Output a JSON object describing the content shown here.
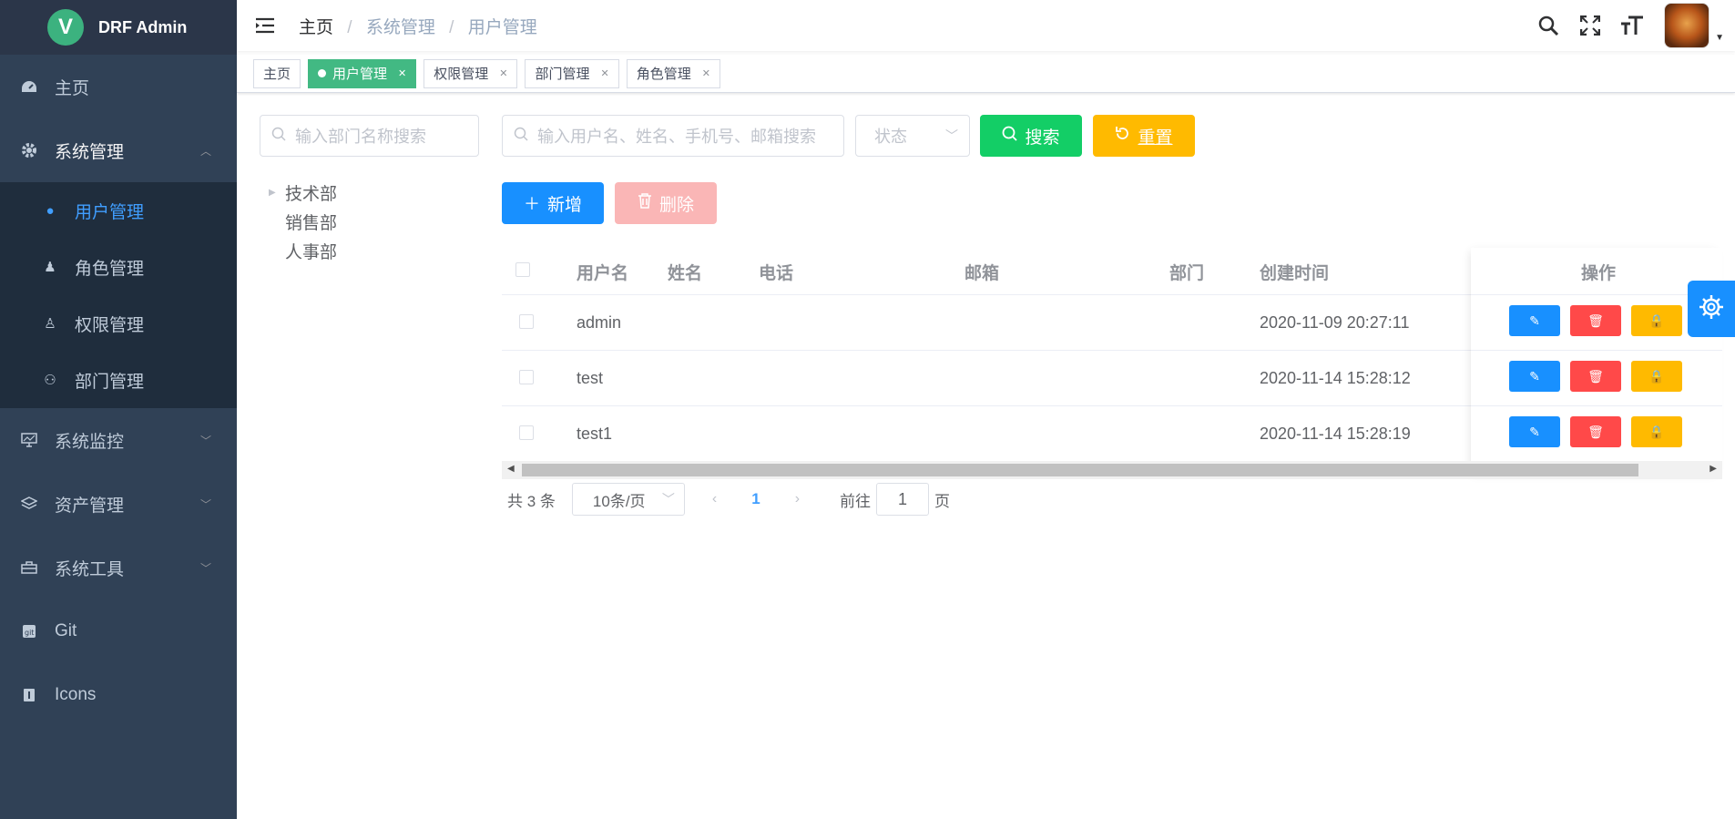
{
  "app": {
    "logo_letter": "V",
    "title": "DRF Admin"
  },
  "sidebar": {
    "items": [
      {
        "label": "主页",
        "icon": "dashboard-icon"
      },
      {
        "label": "系统管理",
        "icon": "gear-icon",
        "expanded": true,
        "children": [
          {
            "label": "用户管理",
            "icon": "user-icon",
            "active": true
          },
          {
            "label": "角色管理",
            "icon": "role-icon"
          },
          {
            "label": "权限管理",
            "icon": "permission-icon"
          },
          {
            "label": "部门管理",
            "icon": "org-tree-icon"
          }
        ]
      },
      {
        "label": "系统监控",
        "icon": "monitor-icon"
      },
      {
        "label": "资产管理",
        "icon": "layers-icon"
      },
      {
        "label": "系统工具",
        "icon": "toolbox-icon"
      },
      {
        "label": "Git",
        "icon": "git-icon"
      },
      {
        "label": "Icons",
        "icon": "icons-icon"
      }
    ]
  },
  "breadcrumb": [
    "主页",
    "系统管理",
    "用户管理"
  ],
  "tags": [
    {
      "label": "主页"
    },
    {
      "label": "用户管理",
      "active": true
    },
    {
      "label": "权限管理"
    },
    {
      "label": "部门管理"
    },
    {
      "label": "角色管理"
    }
  ],
  "dept_search": {
    "placeholder": "输入部门名称搜索"
  },
  "user_search": {
    "placeholder": "输入用户名、姓名、手机号、邮箱搜索"
  },
  "status_select": {
    "placeholder": "状态"
  },
  "buttons": {
    "search": "搜索",
    "reset": "重置",
    "add": "新增",
    "delete": "删除"
  },
  "dept_tree": [
    "技术部",
    "销售部",
    "人事部"
  ],
  "table": {
    "columns": [
      "用户名",
      "姓名",
      "电话",
      "邮箱",
      "部门",
      "创建时间",
      "操作"
    ],
    "rows": [
      {
        "username": "admin",
        "name": "",
        "phone": "",
        "email": "",
        "dept": "",
        "created": "2020-11-09 20:27:11"
      },
      {
        "username": "test",
        "name": "",
        "phone": "",
        "email": "",
        "dept": "",
        "created": "2020-11-14 15:28:12"
      },
      {
        "username": "test1",
        "name": "",
        "phone": "",
        "email": "",
        "dept": "",
        "created": "2020-11-14 15:28:19"
      }
    ]
  },
  "pagination": {
    "total_text": "共 3 条",
    "page_size": "10条/页",
    "current_page": "1",
    "goto_prefix": "前往",
    "goto_value": "1",
    "goto_suffix": "页"
  },
  "colors": {
    "sidebar_bg": "#304156",
    "active": "#409eff",
    "tag_active": "#42b983",
    "search_btn": "#13ce66",
    "reset_btn": "#ffba00",
    "add_btn": "#1890ff",
    "delete_btn_disabled": "#fab6b6"
  }
}
